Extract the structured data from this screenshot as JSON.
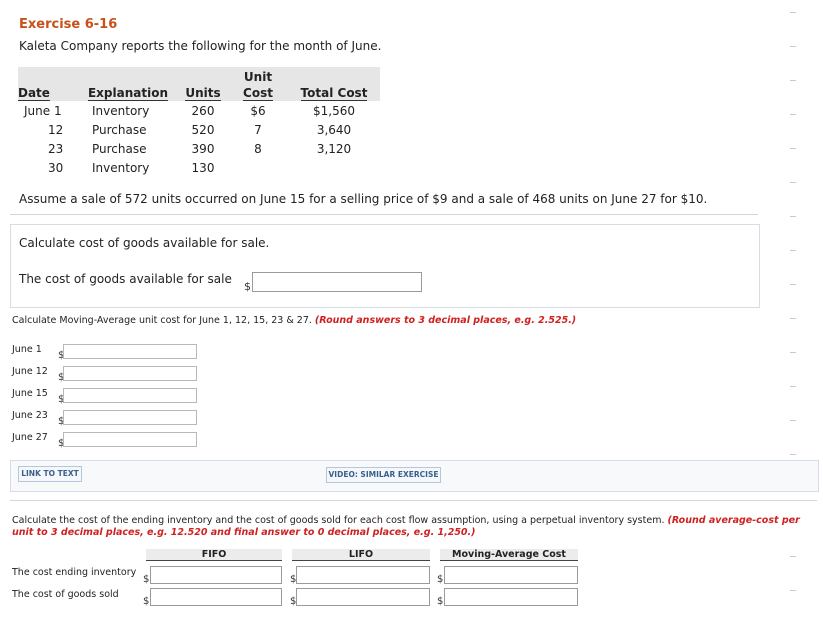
{
  "exercise": {
    "title": "Exercise 6-16",
    "intro": "Kaleta Company reports the following for the month of June."
  },
  "table": {
    "headers": {
      "date": "Date",
      "explanation": "Explanation",
      "units": "Units",
      "unit_cost_top": "Unit",
      "unit_cost_bottom": "Cost",
      "total_cost": "Total Cost"
    },
    "rows": [
      {
        "date": "June 1",
        "explanation": "Inventory",
        "units": "260",
        "unit_cost": "$6",
        "total_cost": "$1,560"
      },
      {
        "date": "12",
        "explanation": "Purchase",
        "units": "520",
        "unit_cost": "7",
        "total_cost": "3,640"
      },
      {
        "date": "23",
        "explanation": "Purchase",
        "units": "390",
        "unit_cost": "8",
        "total_cost": "3,120"
      },
      {
        "date": "30",
        "explanation": "Inventory",
        "units": "130",
        "unit_cost": "",
        "total_cost": ""
      }
    ]
  },
  "assume_text": "Assume a sale of 572 units occurred on June 15 for a selling price of $9 and a sale of 468 units on June 27 for $10.",
  "part1": {
    "prompt": "Calculate cost of goods available for sale.",
    "label": "The cost of goods available for sale",
    "currency": "$",
    "value": ""
  },
  "part2": {
    "prompt": "Calculate Moving-Average unit cost for June 1, 12, 15, 23 & 27.",
    "note": "(Round answers to 3 decimal places, e.g. 2.525.)",
    "currency": "$",
    "rows": [
      {
        "label": "June 1",
        "value": ""
      },
      {
        "label": "June 12",
        "value": ""
      },
      {
        "label": "June 15",
        "value": ""
      },
      {
        "label": "June 23",
        "value": ""
      },
      {
        "label": "June 27",
        "value": ""
      }
    ],
    "link_text": "LINK TO TEXT",
    "video_text": "VIDEO: SIMILAR EXERCISE"
  },
  "part3": {
    "prompt": "Calculate the cost of the ending inventory and the cost of goods sold for each cost flow assumption, using a perpetual inventory system.",
    "note": "(Round average-cost per unit to 3 decimal places, e.g. 12.520 and final answer to 0 decimal places, e.g. 1,250.)",
    "columns": [
      "FIFO",
      "LIFO",
      "Moving-Average Cost"
    ],
    "currency": "$",
    "rows": [
      {
        "label": "The cost ending inventory"
      },
      {
        "label": "The cost of goods sold"
      }
    ]
  }
}
